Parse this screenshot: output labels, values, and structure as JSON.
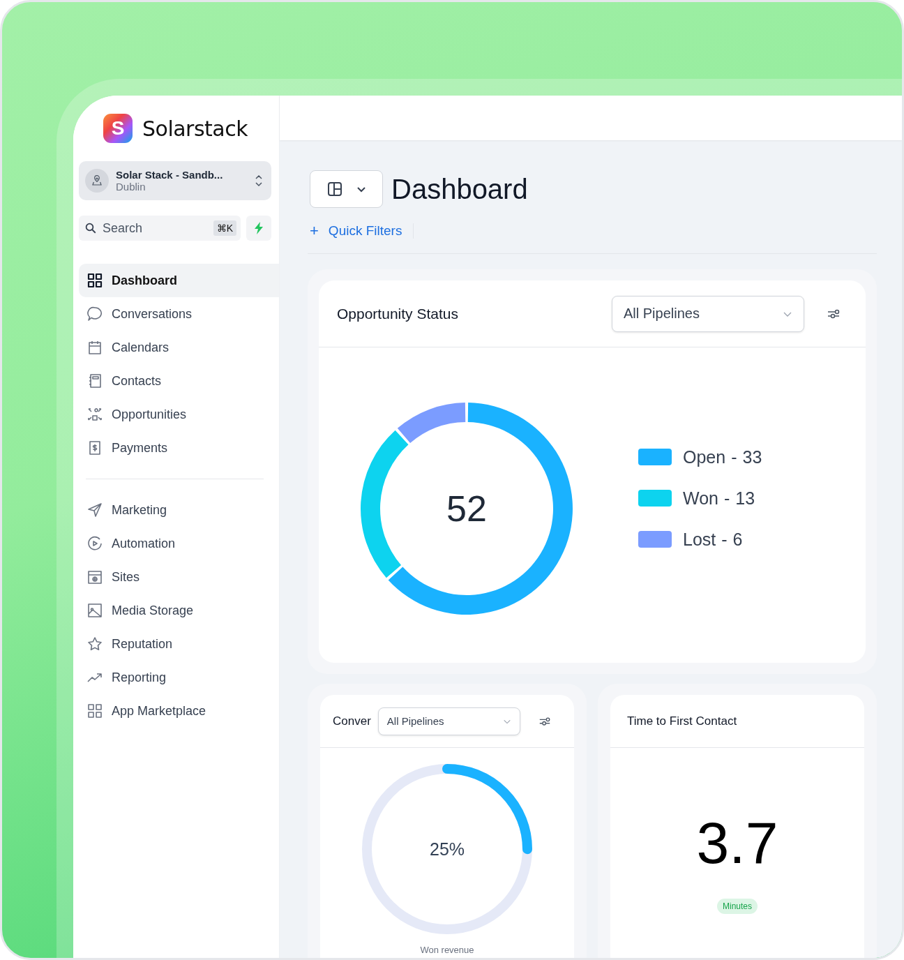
{
  "brand": {
    "mark": "S",
    "name": "Solarstack"
  },
  "account": {
    "name": "Solar Stack - Sandb...",
    "location": "Dublin"
  },
  "search": {
    "placeholder": "Search",
    "shortcut": "⌘K"
  },
  "nav_groups": [
    {
      "items": [
        {
          "label": "Dashboard",
          "selected": true
        },
        {
          "label": "Conversations",
          "selected": false
        },
        {
          "label": "Calendars",
          "selected": false
        },
        {
          "label": "Contacts",
          "selected": false
        },
        {
          "label": "Opportunities",
          "selected": false
        },
        {
          "label": "Payments",
          "selected": false
        }
      ]
    },
    {
      "items": [
        {
          "label": "Marketing",
          "selected": false
        },
        {
          "label": "Automation",
          "selected": false
        },
        {
          "label": "Sites",
          "selected": false
        },
        {
          "label": "Media Storage",
          "selected": false
        },
        {
          "label": "Reputation",
          "selected": false
        },
        {
          "label": "Reporting",
          "selected": false
        },
        {
          "label": "App Marketplace",
          "selected": false
        }
      ]
    }
  ],
  "page_title": "Dashboard",
  "quick_filters": {
    "icon": "+",
    "label": "Quick Filters"
  },
  "opportunity_card": {
    "title": "Opportunity Status",
    "dropdown": "All Pipelines",
    "total": "52",
    "legend": [
      {
        "separator": "-",
        "count": "33",
        "color": "#1ab2ff"
      },
      {
        "separator": "-",
        "count": "13",
        "color": "#0dd3ef"
      },
      {
        "separator": "-",
        "count": "6",
        "color": "#7b9cff"
      }
    ],
    "chart_data": {
      "type": "donut",
      "categories": [
        "Open",
        "Won",
        "Lost"
      ],
      "values": [
        63.46,
        25,
        11.54
      ]
    }
  },
  "conversion_card": {
    "title": "Conver",
    "dropdown": "All Pipelines",
    "reading": "25%",
    "level": 0.25,
    "caption": "Won revenue"
  },
  "contact_card": {
    "title": "Time to First Contact",
    "value": "3.7",
    "unit": "Minutes"
  }
}
